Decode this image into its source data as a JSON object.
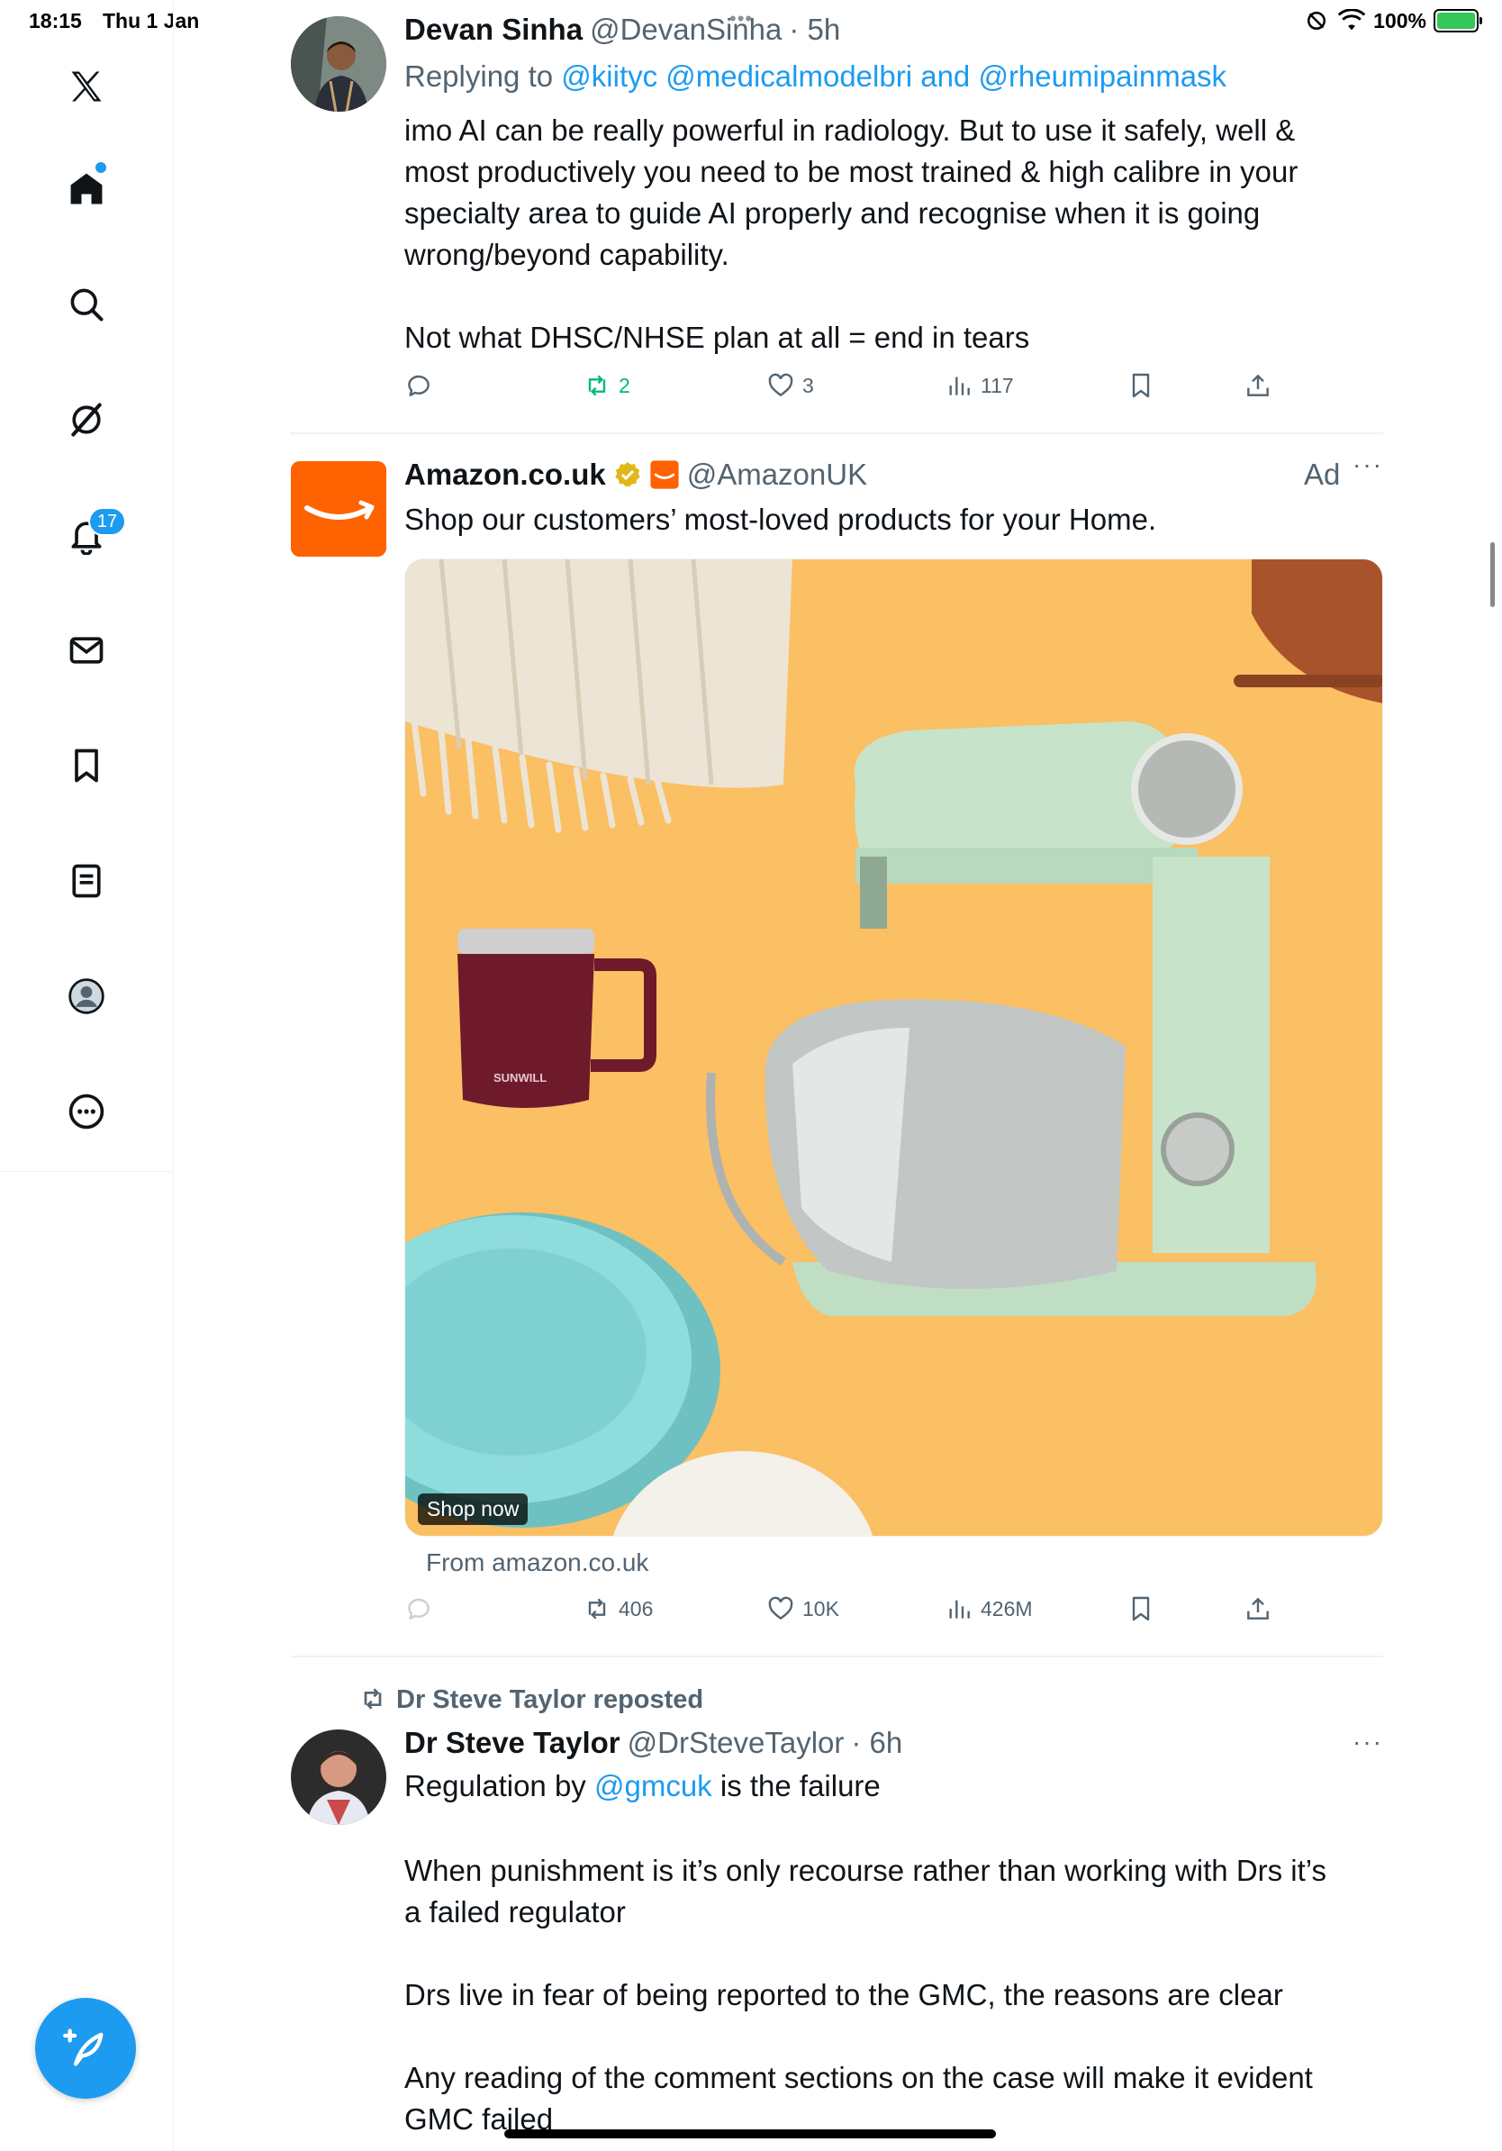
{
  "status_bar": {
    "time": "18:15",
    "date": "Thu 1 Jan",
    "battery": "100%"
  },
  "sidebar": {
    "notifications_badge": "17"
  },
  "posts": [
    {
      "name": "Devan Sinha",
      "handle": "@DevanSinha",
      "time": "· 5h",
      "replying_label": "Replying to",
      "replying_to": "@kiityc @medicalmodelbri and @rheumipainmask",
      "lines": [
        "imo AI can be really powerful in radiology. But to use it safely, well &",
        "most productively you need to be most trained & high calibre in your",
        "specialty area to guide AI properly and recognise when it is going",
        "wrong/beyond capability.",
        "Not what DHSC/NHSE plan at all = end in tears"
      ],
      "retweets": "2",
      "likes": "3",
      "views": "117"
    },
    {
      "name": "Amazon.co.uk",
      "handle": "@AmazonUK",
      "ad_label": "Ad",
      "text": "Shop our customers’ most-loved products for your Home.",
      "shop_now": "Shop now",
      "mug_brand": "SUNWILL",
      "source": "From amazon.co.uk",
      "retweets": "406",
      "likes": "10K",
      "views": "426M"
    },
    {
      "repost_label": "Dr Steve Taylor reposted",
      "name": "Dr Steve Taylor",
      "handle": "@DrSteveTaylor",
      "time": "· 6h",
      "line1_pre": "Regulation by ",
      "line1_link": "@gmcuk",
      "line1_post": " is the failure",
      "lines": [
        "When punishment is it’s only recourse rather than working with Drs it’s",
        "a failed regulator",
        "Drs live in fear of being reported to the GMC, the reasons are clear",
        "Any reading of the comment sections on the case will make it evident",
        "GMC failed"
      ]
    }
  ],
  "colors": {
    "accent": "#1d9bf0",
    "retweet_green": "#00ba7c",
    "amazon_orange": "#ff6200",
    "ad_background": "#fbbf64"
  }
}
